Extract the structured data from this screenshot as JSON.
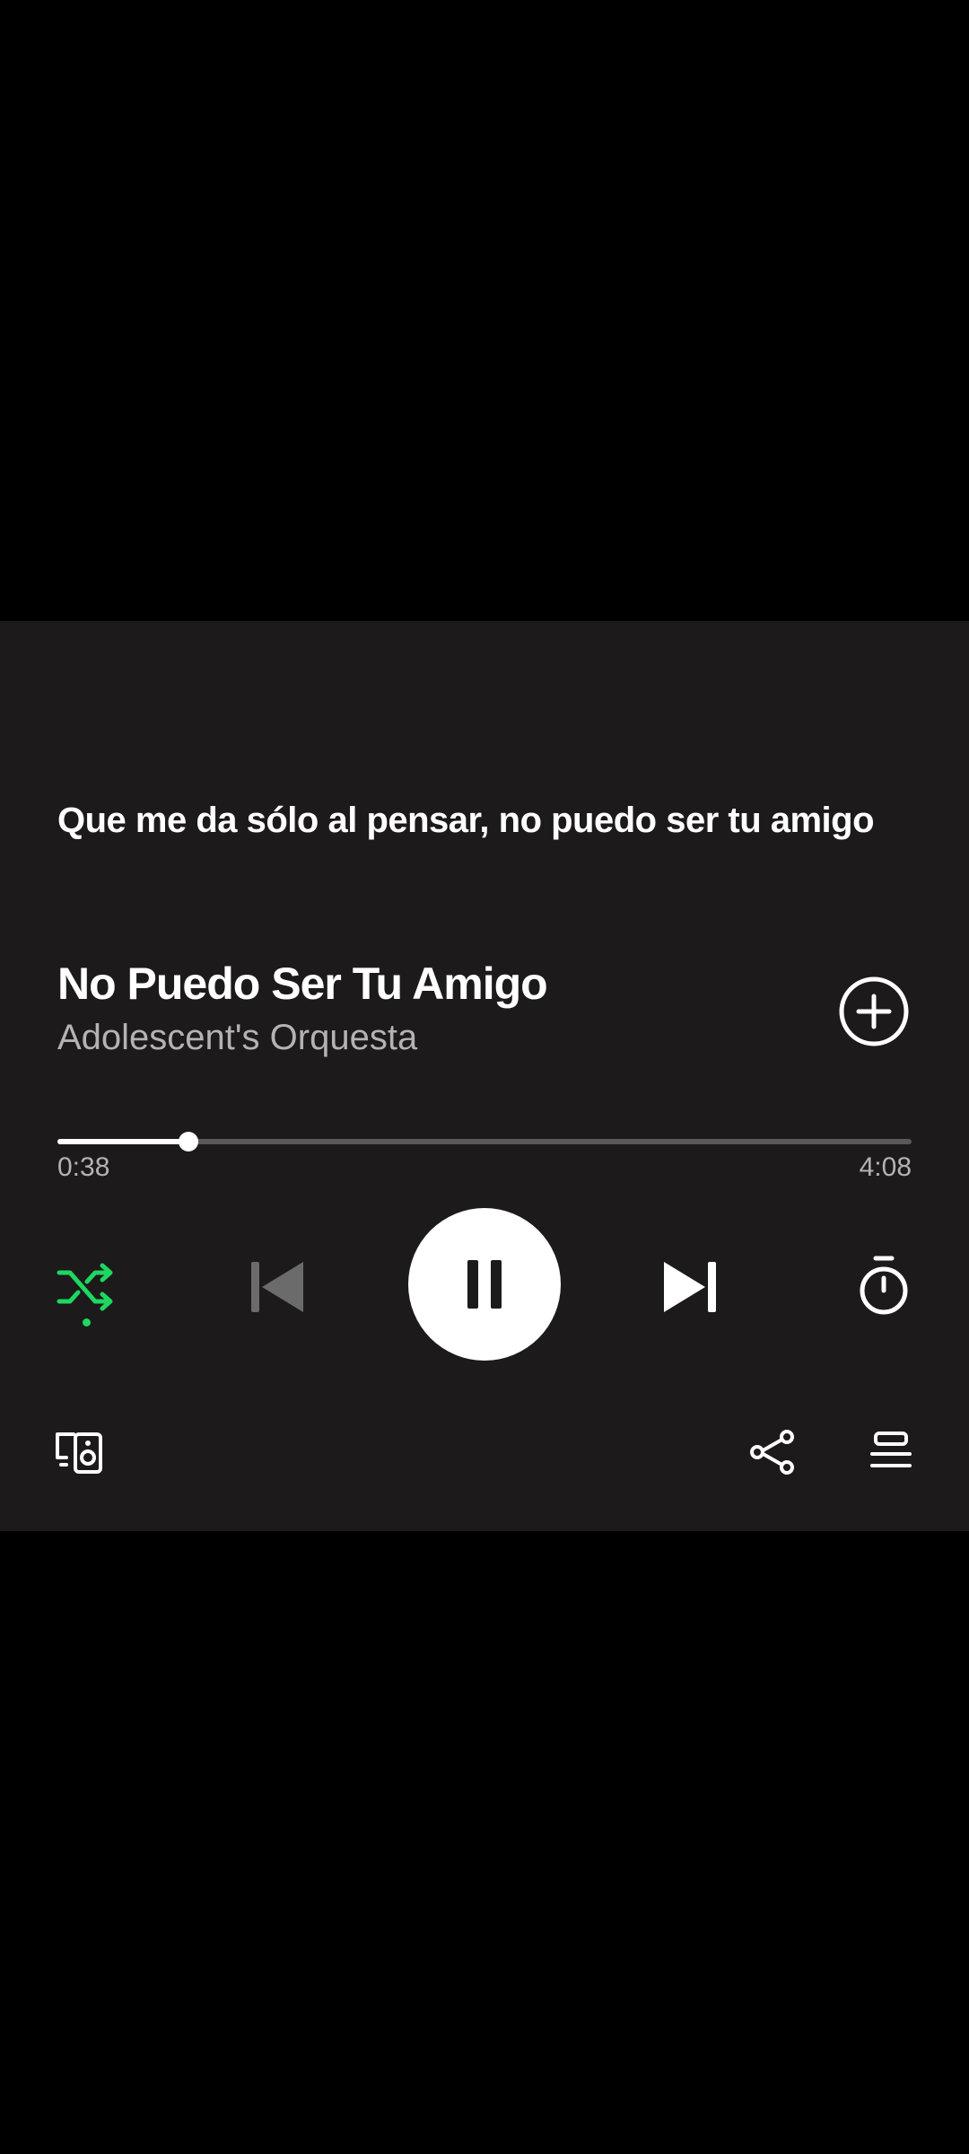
{
  "lyrics": {
    "current_line": "Que me da sólo al pensar, no puedo ser tu amigo"
  },
  "track": {
    "title": "No Puedo Ser Tu Amigo",
    "artist": "Adolescent's Orquesta"
  },
  "playback": {
    "elapsed": "0:38",
    "duration": "4:08",
    "progress_fraction": 0.153,
    "state": "playing",
    "shuffle_enabled": true
  },
  "icons": {
    "add": "add-circle-icon",
    "shuffle": "shuffle-icon",
    "previous": "skip-previous-icon",
    "pause": "pause-icon",
    "next": "skip-next-icon",
    "sleep_timer": "timer-icon",
    "devices": "connect-devices-icon",
    "share": "share-icon",
    "queue": "queue-icon"
  },
  "colors": {
    "background": "#000000",
    "player_background": "#1c1a1b",
    "accent": "#1ed760",
    "text_primary": "#ffffff",
    "text_secondary": "#b3b3b3",
    "track_inactive": "#5a5859",
    "disabled": "#6b6b6b"
  }
}
